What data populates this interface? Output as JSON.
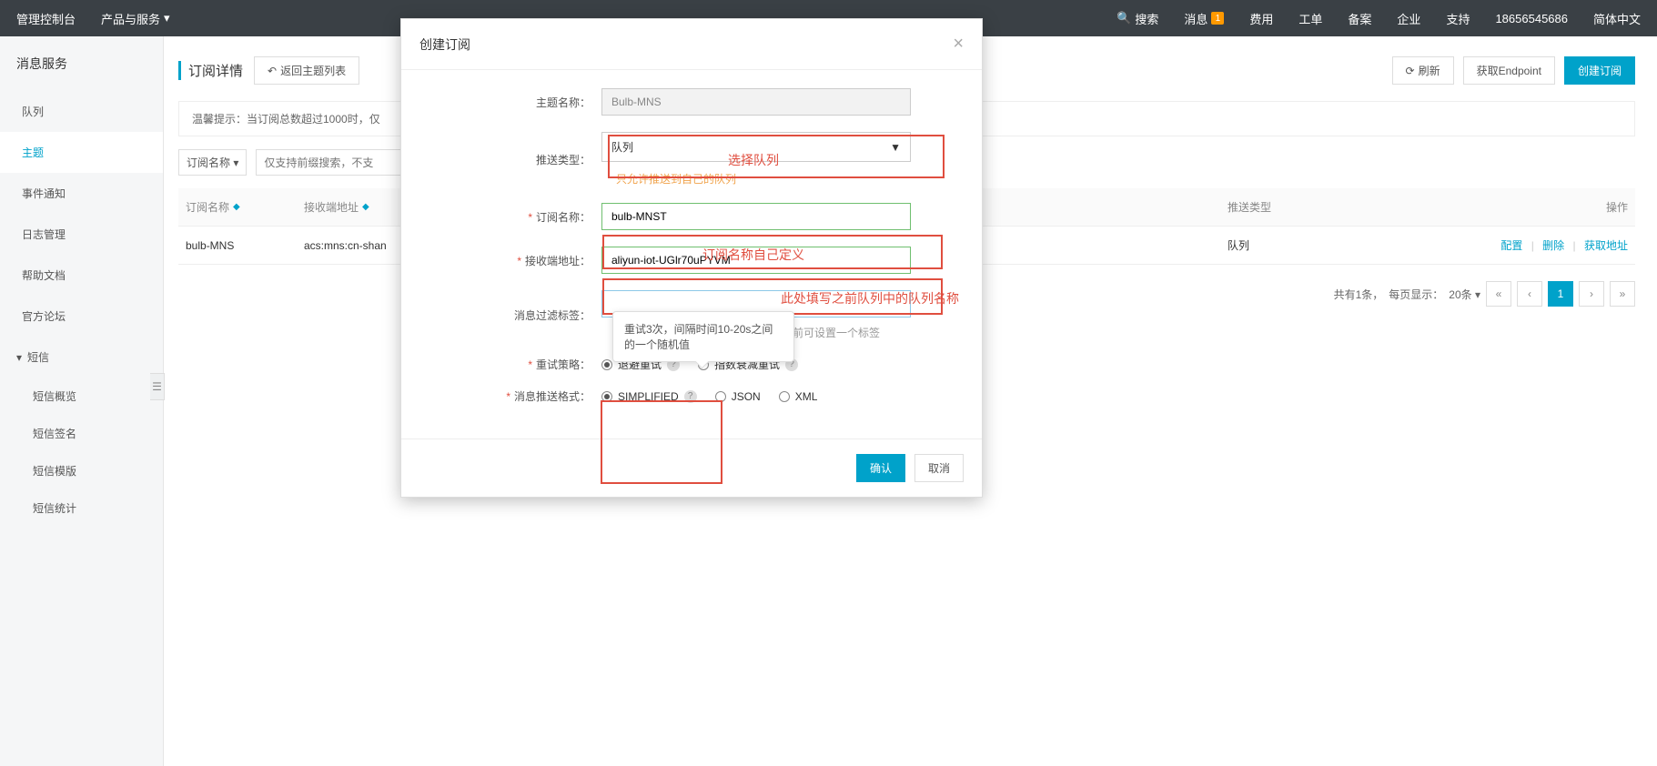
{
  "topnav": {
    "console": "管理控制台",
    "products": "产品与服务",
    "search": "搜索",
    "messages": "消息",
    "badge": "1",
    "billing": "费用",
    "tickets": "工单",
    "icp": "备案",
    "enterprise": "企业",
    "support": "支持",
    "phone": "18656545686",
    "lang": "简体中文"
  },
  "sidebar": {
    "service": "消息服务",
    "queue": "队列",
    "topic": "主题",
    "event": "事件通知",
    "log": "日志管理",
    "help": "帮助文档",
    "forum": "官方论坛",
    "sms_section": "短信",
    "sms_overview": "短信概览",
    "sms_sign": "短信签名",
    "sms_tpl": "短信模版",
    "sms_stats": "短信统计"
  },
  "main": {
    "title": "订阅详情",
    "back": "返回主题列表",
    "refresh": "刷新",
    "endpoint": "获取Endpoint",
    "create": "创建订阅",
    "tip": "温馨提示：当订阅总数超过1000时，仅",
    "filter_select": "订阅名称",
    "filter_placeholder": "仅支持前缀搜索，不支",
    "table": {
      "col_name": "订阅名称",
      "col_addr": "接收端地址",
      "col_type": "推送类型",
      "col_ops": "操作",
      "row": {
        "name": "bulb-MNS",
        "addr": "acs:mns:cn-shan",
        "type": "队列",
        "config": "配置",
        "delete": "删除",
        "geturl": "获取地址"
      }
    },
    "pager": {
      "total": "共有1条，",
      "size_label": "每页显示：",
      "size": "20条",
      "current": "1"
    }
  },
  "modal": {
    "title": "创建订阅",
    "topic_label": "主题名称：",
    "topic_value": "Bulb-MNS",
    "push_type_label": "推送类型：",
    "push_type_value": "队列",
    "push_hint": "只允许推送到自己的队列",
    "sub_name_label": "订阅名称：",
    "sub_name_value": "bulb-MNST",
    "endpoint_label": "接收端地址：",
    "endpoint_value": "aliyun-iot-UGlr70uPYVM",
    "tag_label": "消息过滤标签：",
    "tag_hint": "前可设置一个标签",
    "retry_label": "重试策略：",
    "retry_backoff": "退避重试",
    "retry_exp": "指数衰减重试",
    "format_label": "消息推送格式：",
    "format_simplified": "SIMPLIFIED",
    "format_json": "JSON",
    "format_xml": "XML",
    "tooltip": "重试3次，间隔时间10-20s之间的一个随机值",
    "ok": "确认",
    "cancel": "取消"
  },
  "annotations": {
    "select_queue": "选择队列",
    "custom_name": "订阅名称自己定义",
    "queue_name_hint": "此处填写之前队列中的队列名称"
  }
}
